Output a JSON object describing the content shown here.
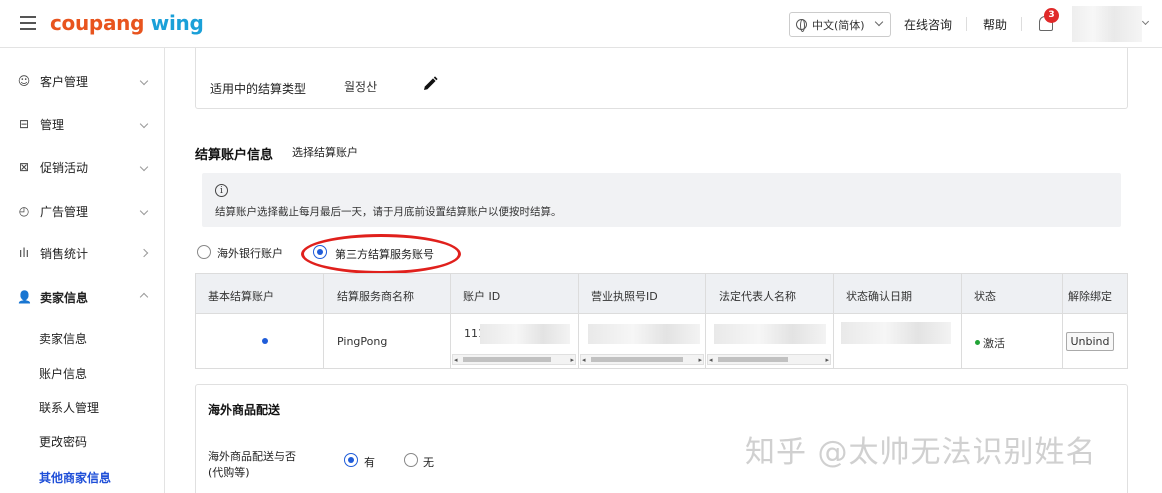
{
  "header": {
    "logo_part1": "coupang",
    "logo_part2": "wing",
    "language": "中文(简体)",
    "live_chat": "在线咨询",
    "help": "帮助",
    "notification_count": "3"
  },
  "sidebar": {
    "items": [
      {
        "label": "客户管理",
        "icon": "smile-icon"
      },
      {
        "label": "管理",
        "icon": "box-icon"
      },
      {
        "label": "促销活动",
        "icon": "ticket-icon"
      },
      {
        "label": "广告管理",
        "icon": "clock-icon"
      },
      {
        "label": "销售统计",
        "icon": "bar-chart-icon"
      },
      {
        "label": "卖家信息",
        "icon": "user-icon"
      }
    ],
    "subitems": [
      "卖家信息",
      "账户信息",
      "联系人管理",
      "更改密码",
      "其他商家信息"
    ]
  },
  "settlement_type": {
    "label": "适用中的结算类型",
    "value": "월정산"
  },
  "account_section": {
    "title": "结算账户信息",
    "link": "选择结算账户",
    "notice": "结算账户选择截止每月最后一天，请于月底前设置结算账户以便按时结算。",
    "radio_overseas": "海外银行账户",
    "radio_third_party": "第三方结算服务账号",
    "selected": "third_party"
  },
  "table": {
    "headers": [
      "基本结算账户",
      "结算服务商名称",
      "账户 ID",
      "营业执照号ID",
      "法定代表人名称",
      "状态确认日期",
      "状态",
      "解除绑定"
    ],
    "row": {
      "provider": "PingPong",
      "account_id": "111",
      "status": "激活",
      "unbind": "Unbind"
    }
  },
  "overseas_delivery": {
    "title": "海外商品配送",
    "question_line1": "海外商品配送与否",
    "question_line2": "(代购等)",
    "yes": "有",
    "no": "无",
    "selected": "yes"
  },
  "watermark": "知乎 @太帅无法识别姓名"
}
